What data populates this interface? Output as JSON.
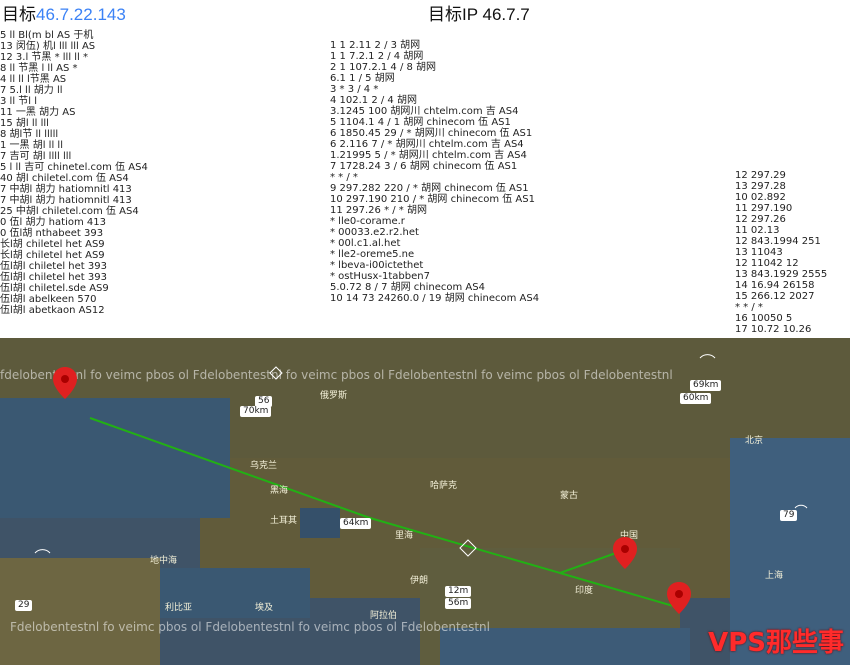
{
  "header": {
    "left_prefix": "目标",
    "left_ip": "46.7.22.143",
    "right_prefix": "目标IP",
    "right_value": "46.7.7"
  },
  "trace_left": [
    "5  ll   Bl(m   bl   AS   于机",
    "13  闵伍)  机l   lll   lll   AS",
    "12  3.l  节黑  *   lll   ll  *",
    "8  ll   节黑   l  ll   AS   *",
    "4  ll  ll  l节黑  AS",
    "7  5.l   ll  胡力   ll",
    "3  ll   节l  l",
    "11  一黑  胡力  AS",
    "15  胡l  ll   lll",
    "8  胡l节  ll lllll",
    "1  一黑 胡l  ll ll",
    "7  吉可   胡l  llll lll",
    "5  l  ll 吉可  chinetel.com 伍  AS4",
    "40  胡l  chiletel.com 伍  AS4",
    "7  中胡l  胡力 hatiomnitl   413",
    "7  中胡l  胡力 hatiomnitl   413",
    "25  中胡l  chiletel.com 伍  AS4",
    "0  伍l  胡力 hatiom  413",
    "0  伍l胡  nthabeet  393",
    "  长l胡  chiletel het   AS9",
    "  长l胡  chiletel het   AS9",
    "  伍l胡l  chiletel het   393",
    "  伍l胡l  chiletel het   393",
    "  伍l胡l  chiletel.sde   AS9",
    "  伍l胡l  abelkeen   570",
    "  伍l胡l  abetkaon   AS12"
  ],
  "trace_mid": [
    "1  1  2.11  2 / 3  胡网",
    "1  1  7.2.1  2 / 4  胡网",
    "2  1  107.2.1  4 / 8  胡网",
    "  6.1  1 / 5  胡网",
    "3  *  3 / 4  *",
    "4  102.1  2 / 4  胡网",
    "  3.1245  100  胡网川 chtelm.com 吉  AS4",
    "5  1104.1  4 / 1  胡网 chinecom 伍  AS1",
    "6  1850.45  29 / *  胡网川 chinecom 伍  AS1",
    "6  2.116  7 / *  胡网川 chtelm.com 吉  AS4",
    "  1.21995  5 / *  胡网川 chtelm.com 吉  AS4",
    "7  1728.24  3 / 6  胡网 chinecom 伍  AS1",
    "  *  * / *",
    "9  297.282  220 / *  胡网 chinecom 伍  AS1",
    "10  297.190  210 / *  胡网 chinecom 伍  AS1",
    "11  297.26  * / *  胡网",
    "  *  lle0-corame.r",
    "  *  00033.e2.r2.het",
    "  *  00l.c1.al.het",
    "  *  lle2-oreme5.ne",
    "  *  lbeva-i00ictethet",
    "  *  ostHusx-1tabben7",
    "5.0.72  8 / 7  胡网 chinecom AS4",
    "10 14 73  24260.0 / 19  胡网 chinecom AS4"
  ],
  "trace_right": [
    "12  297.29",
    "13  297.28",
    "10  02.892",
    "11  297.190",
    "12  297.26",
    "11  02.13",
    "12  843.1994  251",
    "13  11043",
    "12  11042  12",
    "13  843.1929  2555",
    "14  16.94  26158",
    "15  266.12  2027",
    "  *  * / *",
    "16  10050  5",
    "17  10.72  10.26"
  ],
  "map": {
    "distances": [
      "56",
      "64km",
      "60km",
      "69km",
      "79",
      "12m",
      "56m",
      "70km",
      "29"
    ],
    "places": [
      "俄罗斯",
      "乌克兰",
      "哈萨克",
      "蒙古",
      "中国",
      "伊朗",
      "印度",
      "阿拉伯",
      "埃及",
      "利比亚",
      "北京",
      "上海",
      "地中海",
      "土耳其",
      "黑海",
      "里海"
    ],
    "watermark": "Fdelobentestnl   fo veimc pbos ol   Fdelobentestnl   fo veimc pbos ol   Fdelobentestnl",
    "watermark_top": "fdelobentestnl fo veimc pbos ol   Fdelobentestnl fo veimc pbos ol   Fdelobentestnl fo veimc pbos ol   Fdelobentestnl",
    "brand": "VPS那些事",
    "colors": {
      "route": "#22b014",
      "pin": "#e02020",
      "land": "#5d5a3c",
      "sea": "#35506a"
    }
  }
}
